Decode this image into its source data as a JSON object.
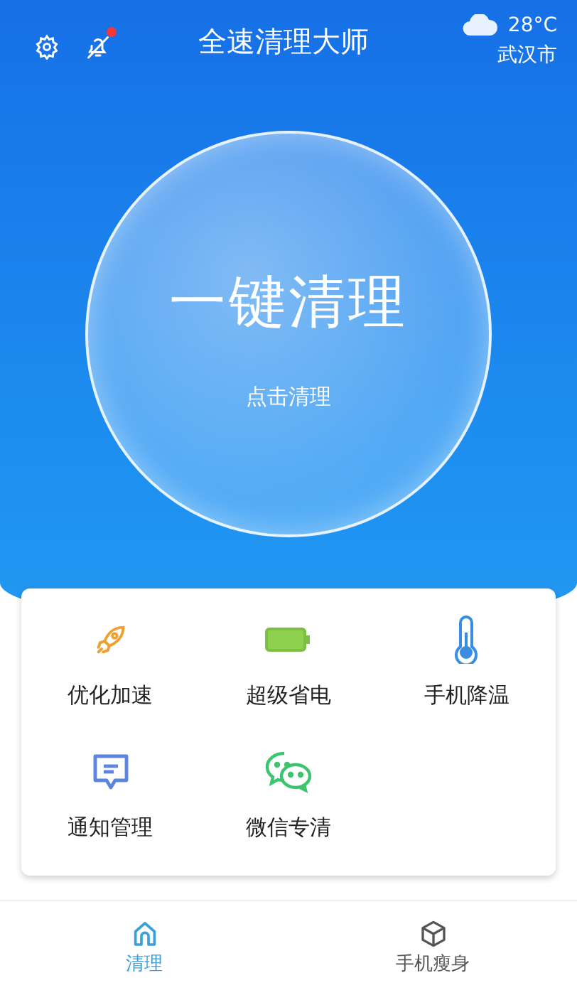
{
  "header": {
    "title": "全速清理大师",
    "temperature": "28°C",
    "city": "武汉市",
    "notification_badge": true
  },
  "clean_button": {
    "title": "一键清理",
    "subtitle": "点击清理"
  },
  "tools": [
    {
      "kind": "rocket",
      "label": "优化加速"
    },
    {
      "kind": "battery",
      "label": "超级省电"
    },
    {
      "kind": "thermometer",
      "label": "手机降温"
    },
    {
      "kind": "message",
      "label": "通知管理"
    },
    {
      "kind": "chat",
      "label": "微信专清"
    }
  ],
  "nav": [
    {
      "kind": "home",
      "label": "清理",
      "selected": true
    },
    {
      "kind": "cube",
      "label": "手机瘦身",
      "selected": false
    }
  ]
}
